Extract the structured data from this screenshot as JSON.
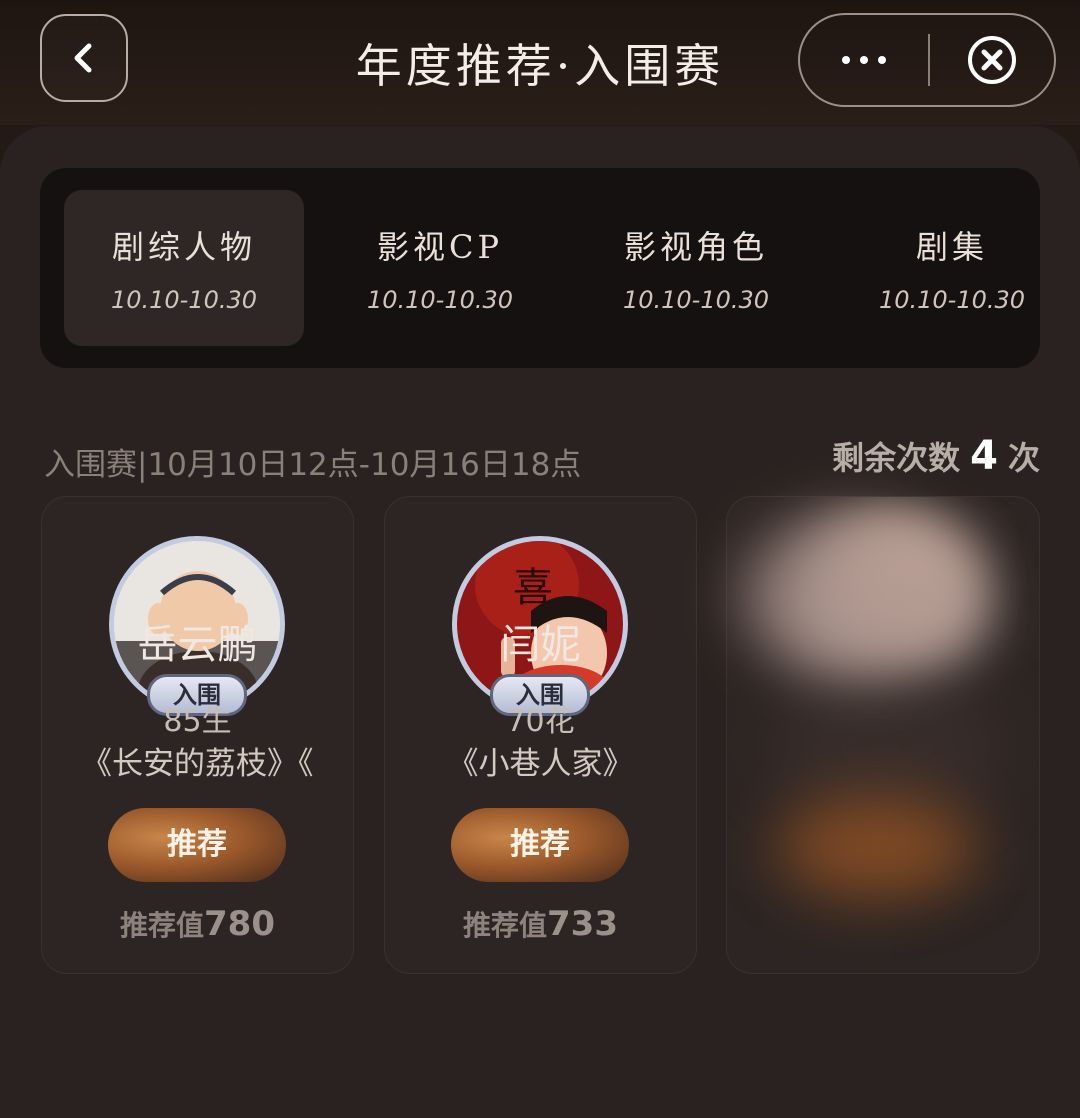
{
  "header": {
    "title": "年度推荐·入围赛",
    "back_icon": "chevron-left-icon",
    "more_icon": "more-dots-icon",
    "close_icon": "close-circle-icon"
  },
  "tabs": [
    {
      "label": "剧综人物",
      "date": "10.10-10.30",
      "active": true
    },
    {
      "label": "影视CP",
      "date": "10.10-10.30",
      "active": false
    },
    {
      "label": "影视角色",
      "date": "10.10-10.30",
      "active": false
    },
    {
      "label": "剧集",
      "date": "10.10-10.30",
      "active": false
    }
  ],
  "round_info": {
    "text": "入围赛|10月10日12点-10月16日18点",
    "remaining_label": "剩余次数",
    "remaining_count": "4",
    "remaining_unit": "次"
  },
  "cards": [
    {
      "badge": "入围",
      "name": "岳云鹏",
      "tag": "85生",
      "works": "《长安的荔枝》《三",
      "button": "推荐",
      "value_label": "推荐值",
      "value": "780"
    },
    {
      "badge": "入围",
      "name": "闫妮",
      "tag": "70花",
      "works": "《小巷人家》",
      "button": "推荐",
      "value_label": "推荐值",
      "value": "733"
    }
  ],
  "colors": {
    "accent_button": "#9c5a2c",
    "badge_border": "#5f667d",
    "background": "#231a16"
  }
}
